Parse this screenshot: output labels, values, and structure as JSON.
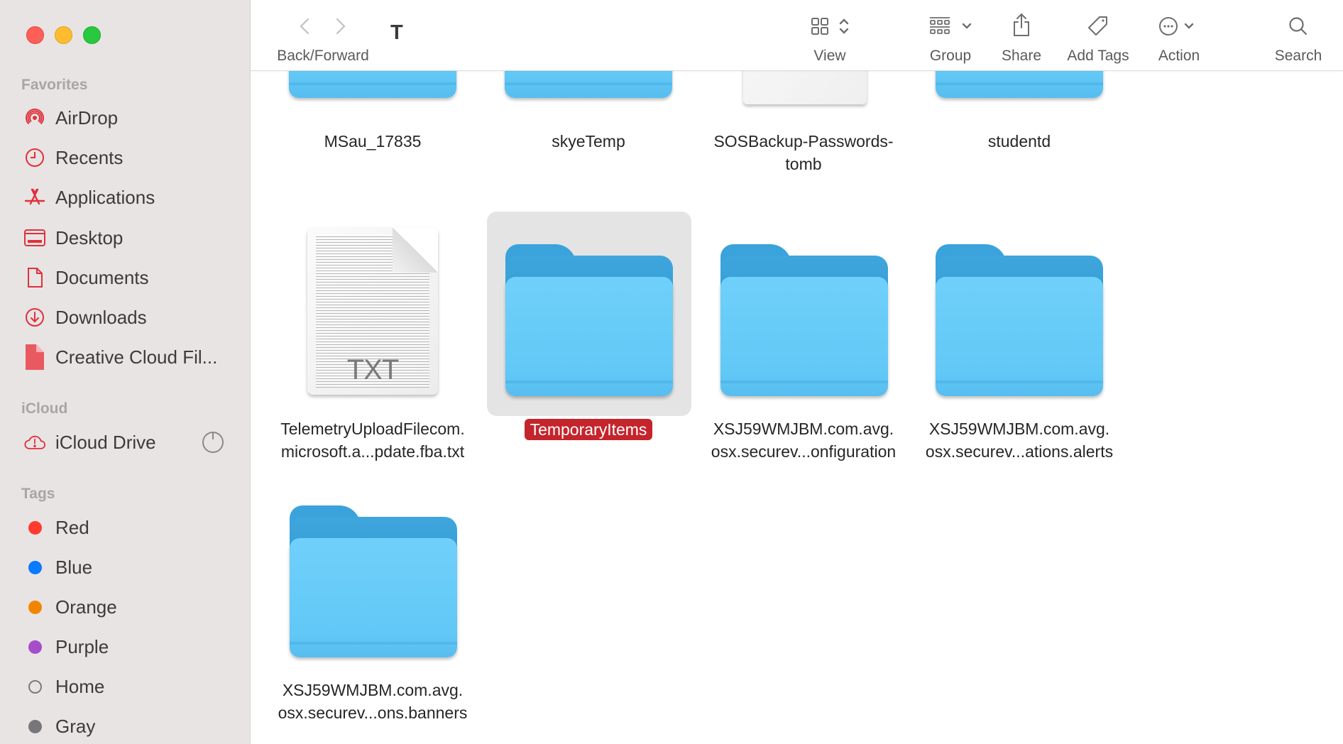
{
  "window": {
    "title": "T",
    "traffic_lights": [
      "close",
      "minimize",
      "zoom"
    ]
  },
  "toolbar": {
    "back_forward_label": "Back/Forward",
    "view_label": "View",
    "group_label": "Group",
    "share_label": "Share",
    "add_tags_label": "Add Tags",
    "action_label": "Action",
    "search_label": "Search"
  },
  "sidebar": {
    "favorites_header": "Favorites",
    "favorites": [
      {
        "label": "AirDrop",
        "icon": "airdrop-icon"
      },
      {
        "label": "Recents",
        "icon": "clock-icon"
      },
      {
        "label": "Applications",
        "icon": "applications-icon"
      },
      {
        "label": "Desktop",
        "icon": "desktop-icon"
      },
      {
        "label": "Documents",
        "icon": "document-icon"
      },
      {
        "label": "Downloads",
        "icon": "download-icon"
      },
      {
        "label": "Creative Cloud Fil...",
        "icon": "file-icon"
      }
    ],
    "icloud_header": "iCloud",
    "icloud": [
      {
        "label": "iCloud Drive",
        "icon": "cloud-alert-icon",
        "status": "sync-progress-icon"
      }
    ],
    "tags_header": "Tags",
    "tags": [
      {
        "label": "Red",
        "color": "#ff3b30"
      },
      {
        "label": "Blue",
        "color": "#0a7aff"
      },
      {
        "label": "Orange",
        "color": "#f28500"
      },
      {
        "label": "Purple",
        "color": "#a64ec9"
      },
      {
        "label": "Home",
        "color": "none"
      },
      {
        "label": "Gray",
        "color": "#77767b"
      }
    ],
    "accent_color": "#e0313b"
  },
  "files": [
    {
      "name": "MSau_17835",
      "line1": "MSau_17835",
      "line2": "",
      "kind": "folder",
      "selected": false
    },
    {
      "name": "skyeTemp",
      "line1": "skyeTemp",
      "line2": "",
      "kind": "folder",
      "selected": false
    },
    {
      "name": "SOSBackup-Passwords-tomb",
      "line1": "SOSBackup-Passwords-",
      "line2": "tomb",
      "kind": "document",
      "selected": false
    },
    {
      "name": "studentd",
      "line1": "studentd",
      "line2": "",
      "kind": "folder",
      "selected": false
    },
    {
      "name": "TelemetryUploadFilecom.microsoft.a...pdate.fba.txt",
      "line1": "TelemetryUploadFilecom.",
      "line2": "microsoft.a...pdate.fba.txt",
      "kind": "txt",
      "ext": "TXT",
      "selected": false
    },
    {
      "name": "TemporaryItems",
      "line1": "TemporaryItems",
      "line2": "",
      "kind": "folder",
      "selected": true,
      "selection_color": "#c4242b"
    },
    {
      "name": "XSJ59WMJBM.com.avg.osx.securev...onfiguration",
      "line1": "XSJ59WMJBM.com.avg.",
      "line2": "osx.securev...onfiguration",
      "kind": "folder",
      "selected": false
    },
    {
      "name": "XSJ59WMJBM.com.avg.osx.securev...ations.alerts",
      "line1": "XSJ59WMJBM.com.avg.",
      "line2": "osx.securev...ations.alerts",
      "kind": "folder",
      "selected": false
    },
    {
      "name": "XSJ59WMJBM.com.avg.osx.securev...ons.banners",
      "line1": "XSJ59WMJBM.com.avg.",
      "line2": "osx.securev...ons.banners",
      "kind": "folder",
      "selected": false
    }
  ]
}
